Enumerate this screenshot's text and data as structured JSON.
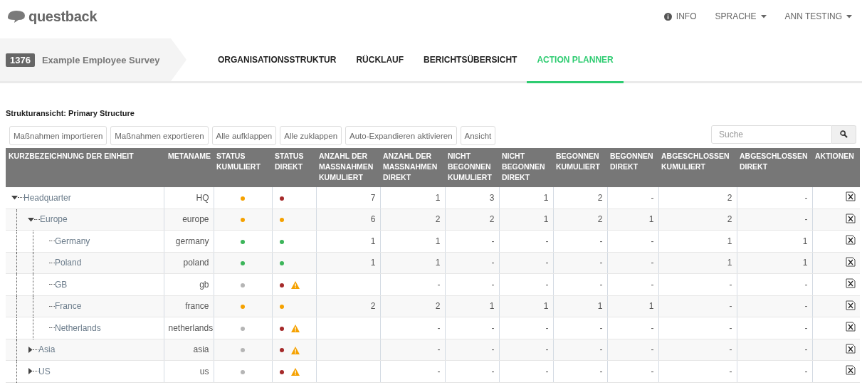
{
  "header": {
    "logo": "questback",
    "menu": [
      {
        "kind": "info",
        "label": "INFO"
      },
      {
        "kind": "dropdown",
        "label": "SPRACHE"
      },
      {
        "kind": "dropdown",
        "label": "ANN TESTING"
      }
    ]
  },
  "project": {
    "id": "1376",
    "name": "Example Employee Survey"
  },
  "tabs": [
    {
      "label": "ORGANISATIONSSTRUKTUR",
      "selected": false
    },
    {
      "label": "RÜCKLAUF",
      "selected": false
    },
    {
      "label": "BERICHTSÜBERSICHT",
      "selected": false
    },
    {
      "label": "ACTION PLANNER",
      "selected": true
    }
  ],
  "structure_title": "Strukturansicht: Primary Structure",
  "toolbar": [
    "Maßnahmen importieren",
    "Maßnahmen exportieren",
    "Alle aufklappen",
    "Alle zuklappen",
    "Auto-Expandieren aktivieren",
    "Ansicht"
  ],
  "search": {
    "placeholder": "Suche"
  },
  "table": {
    "columns": [
      "KURZBEZEICHNUNG DER EINHEIT",
      "METANAME",
      "STATUS KUMULIERT",
      "STATUS DIREKT",
      "ANZAHL DER MASSNAHMEN KUMULIERT",
      "ANZAHL DER MASSNAHMEN DIREKT",
      "NICHT BEGONNEN KUMULIERT",
      "NICHT BEGONNEN DIREKT",
      "BEGONNEN KUMULIERT",
      "BEGONNEN DIREKT",
      "ABGESCHLOSSEN KUMULIERT",
      "ABGESCHLOSSEN DIREKT",
      "AKTIONEN"
    ],
    "rows": [
      {
        "name": "Headquarter",
        "expanded": true,
        "metaname": "HQ",
        "status_cumulative": {
          "color": "#f5a100"
        },
        "status_direct": {
          "color": "#a52a2a",
          "warning": false
        },
        "counts": {
          "actions_cumulative": "7",
          "actions_direct": "1",
          "not_started_cumulative": "3",
          "not_started_direct": "1",
          "started_cumulative": "2",
          "started_direct": "-",
          "completed_cumulative": "2",
          "completed_direct": "-"
        },
        "children": [
          {
            "name": "Europe",
            "expanded": true,
            "metaname": "europe",
            "status_cumulative": {
              "color": "#f5a100"
            },
            "status_direct": {
              "color": "#f5a100",
              "warning": false
            },
            "counts": {
              "actions_cumulative": "6",
              "actions_direct": "2",
              "not_started_cumulative": "2",
              "not_started_direct": "1",
              "started_cumulative": "2",
              "started_direct": "1",
              "completed_cumulative": "2",
              "completed_direct": "-"
            },
            "children": [
              {
                "name": "Germany",
                "metaname": "germany",
                "status_cumulative": {
                  "color": "#3cb55a"
                },
                "status_direct": {
                  "color": "#3cb55a",
                  "warning": false
                },
                "counts": {
                  "actions_cumulative": "1",
                  "actions_direct": "1",
                  "not_started_cumulative": "-",
                  "not_started_direct": "-",
                  "started_cumulative": "-",
                  "started_direct": "-",
                  "completed_cumulative": "1",
                  "completed_direct": "1"
                }
              },
              {
                "name": "Poland",
                "metaname": "poland",
                "status_cumulative": {
                  "color": "#3cb55a"
                },
                "status_direct": {
                  "color": "#3cb55a",
                  "warning": false
                },
                "counts": {
                  "actions_cumulative": "1",
                  "actions_direct": "1",
                  "not_started_cumulative": "-",
                  "not_started_direct": "-",
                  "started_cumulative": "-",
                  "started_direct": "-",
                  "completed_cumulative": "1",
                  "completed_direct": "1"
                }
              },
              {
                "name": "GB",
                "metaname": "gb",
                "status_cumulative": {
                  "color": "#b5b5b5"
                },
                "status_direct": {
                  "color": "#a52a2a",
                  "warning": true
                },
                "counts": {
                  "actions_direct": "-",
                  "not_started_cumulative": "-",
                  "not_started_direct": "-",
                  "started_cumulative": "-",
                  "started_direct": "-",
                  "completed_cumulative": "-",
                  "completed_direct": "-"
                }
              },
              {
                "name": "France",
                "metaname": "france",
                "status_cumulative": {
                  "color": "#f5a100"
                },
                "status_direct": {
                  "color": "#f5a100",
                  "warning": false
                },
                "counts": {
                  "actions_cumulative": "2",
                  "actions_direct": "2",
                  "not_started_cumulative": "1",
                  "not_started_direct": "1",
                  "started_cumulative": "1",
                  "started_direct": "1",
                  "completed_cumulative": "-",
                  "completed_direct": "-"
                }
              },
              {
                "name": "Netherlands",
                "metaname": "netherlands",
                "status_cumulative": {
                  "color": "#b5b5b5"
                },
                "status_direct": {
                  "color": "#a52a2a",
                  "warning": true
                },
                "counts": {
                  "actions_direct": "-",
                  "not_started_cumulative": "-",
                  "not_started_direct": "-",
                  "started_cumulative": "-",
                  "started_direct": "-",
                  "completed_cumulative": "-",
                  "completed_direct": "-"
                }
              }
            ]
          },
          {
            "name": "Asia",
            "expanded": false,
            "metaname": "asia",
            "status_cumulative": {
              "color": "#b5b5b5"
            },
            "status_direct": {
              "color": "#a52a2a",
              "warning": true
            },
            "counts": {
              "actions_direct": "-",
              "not_started_cumulative": "-",
              "not_started_direct": "-",
              "started_cumulative": "-",
              "started_direct": "-",
              "completed_cumulative": "-",
              "completed_direct": "-"
            }
          },
          {
            "name": "US",
            "expanded": false,
            "metaname": "us",
            "status_cumulative": {
              "color": "#b5b5b5"
            },
            "status_direct": {
              "color": "#a52a2a",
              "warning": true
            },
            "counts": {
              "actions_direct": "-",
              "not_started_cumulative": "-",
              "not_started_direct": "-",
              "started_cumulative": "-",
              "started_direct": "-",
              "completed_cumulative": "-",
              "completed_direct": "-"
            }
          }
        ]
      }
    ]
  }
}
